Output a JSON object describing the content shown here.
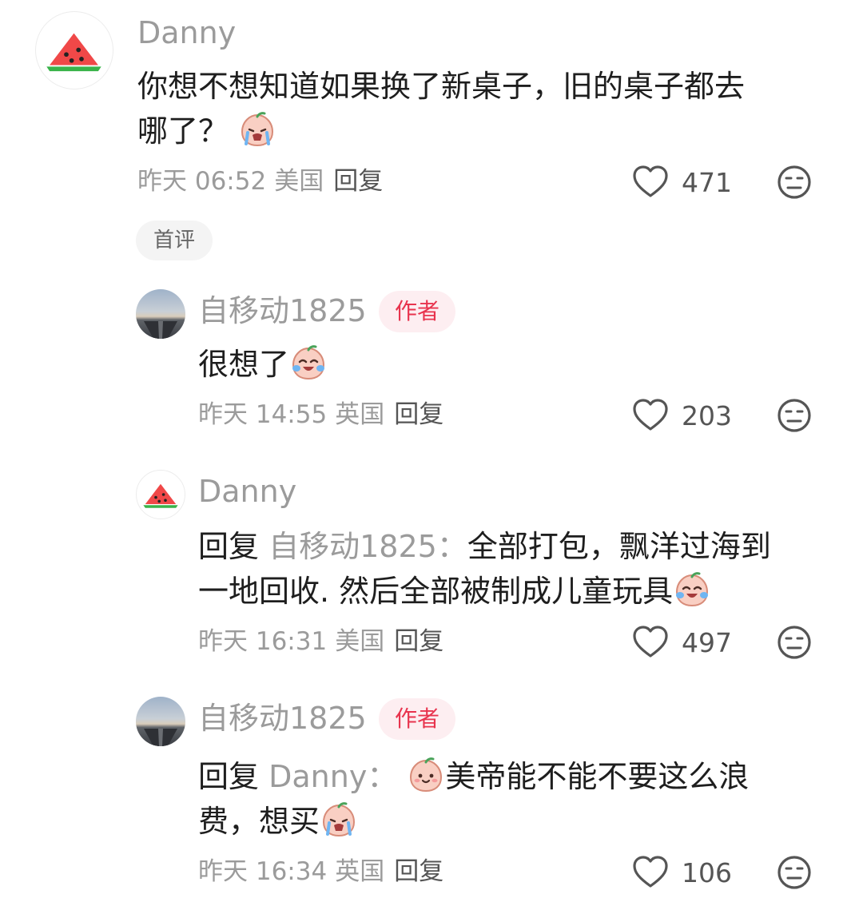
{
  "comments": [
    {
      "user": "Danny",
      "lines": [
        "你想不想知道如果换了新桌子，旧的桌子都去",
        "哪了？"
      ],
      "time": "昨天 06:52",
      "location": "美国",
      "reply_label": "回复",
      "likes": "471",
      "badge": "首评"
    },
    {
      "user": "自移动1825",
      "author_badge": "作者",
      "lines": [
        "很想了"
      ],
      "time": "昨天 14:55",
      "location": "英国",
      "reply_label": "回复",
      "likes": "203"
    },
    {
      "user": "Danny",
      "reply_prefix": "回复",
      "reply_to": "自移动1825：",
      "lines": [
        "全部打包，飘洋过海到",
        "一地回收. 然后全部被制成儿童玩具"
      ],
      "time": "昨天 16:31",
      "location": "美国",
      "reply_label": "回复",
      "likes": "497"
    },
    {
      "user": "自移动1825",
      "author_badge": "作者",
      "reply_prefix": "回复",
      "reply_to": "Danny：",
      "lines": [
        "美帝能不能不要这么浪",
        "费，想买"
      ],
      "time": "昨天 16:34",
      "location": "英国",
      "reply_label": "回复",
      "likes": "106"
    }
  ],
  "icons": {
    "like": "heart-outline-icon",
    "dislike": "meh-face-icon",
    "emoji_cry": "crying-peach-emoji",
    "emoji_laugh": "laugh-cry-peach-emoji",
    "emoji_smile": "smiling-peach-emoji"
  },
  "colors": {
    "username": "#9b9b9b",
    "author_badge_text": "#e8344e",
    "author_badge_bg": "#fdeef1",
    "text": "#1e1e1e",
    "meta": "#9b9b9b"
  }
}
